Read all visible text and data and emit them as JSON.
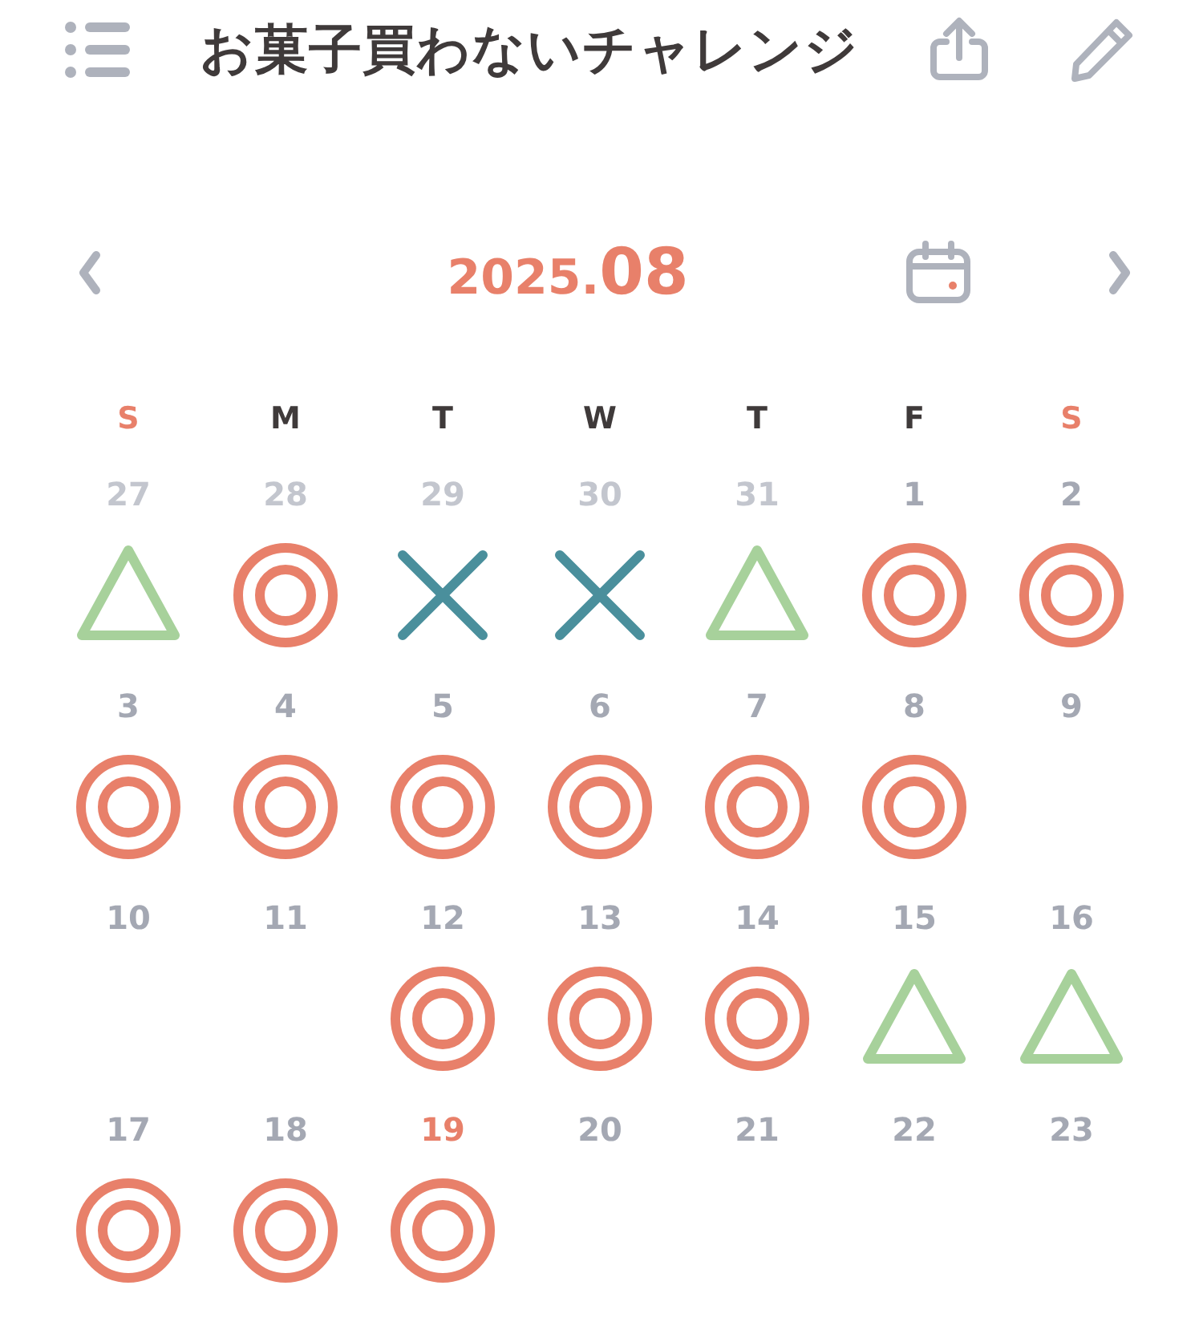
{
  "header": {
    "title": "お菓子買わないチャレンジ"
  },
  "month_nav": {
    "year": "2025.",
    "month": "08"
  },
  "weekdays": [
    {
      "label": "S",
      "holiday": true
    },
    {
      "label": "M",
      "holiday": false
    },
    {
      "label": "T",
      "holiday": false
    },
    {
      "label": "W",
      "holiday": false
    },
    {
      "label": "T",
      "holiday": false
    },
    {
      "label": "F",
      "holiday": false
    },
    {
      "label": "S",
      "holiday": true
    }
  ],
  "days": [
    {
      "day": "27",
      "kind": "outside",
      "mark": {
        "kind": "triangle"
      }
    },
    {
      "day": "28",
      "kind": "outside",
      "mark": {
        "kind": "double_circle"
      }
    },
    {
      "day": "29",
      "kind": "outside",
      "mark": {
        "kind": "cross"
      }
    },
    {
      "day": "30",
      "kind": "outside",
      "mark": {
        "kind": "cross"
      }
    },
    {
      "day": "31",
      "kind": "outside",
      "mark": {
        "kind": "triangle"
      }
    },
    {
      "day": "1",
      "kind": "inside",
      "mark": {
        "kind": "double_circle"
      }
    },
    {
      "day": "2",
      "kind": "inside",
      "mark": {
        "kind": "double_circle"
      }
    },
    {
      "day": "3",
      "kind": "inside",
      "mark": {
        "kind": "double_circle"
      }
    },
    {
      "day": "4",
      "kind": "inside",
      "mark": {
        "kind": "double_circle"
      }
    },
    {
      "day": "5",
      "kind": "inside",
      "mark": {
        "kind": "double_circle"
      }
    },
    {
      "day": "6",
      "kind": "inside",
      "mark": {
        "kind": "double_circle"
      }
    },
    {
      "day": "7",
      "kind": "inside",
      "mark": {
        "kind": "double_circle"
      }
    },
    {
      "day": "8",
      "kind": "inside",
      "mark": {
        "kind": "double_circle"
      }
    },
    {
      "day": "9",
      "kind": "inside"
    },
    {
      "day": "10",
      "kind": "inside"
    },
    {
      "day": "11",
      "kind": "inside"
    },
    {
      "day": "12",
      "kind": "inside",
      "mark": {
        "kind": "double_circle"
      }
    },
    {
      "day": "13",
      "kind": "inside",
      "mark": {
        "kind": "double_circle"
      }
    },
    {
      "day": "14",
      "kind": "inside",
      "mark": {
        "kind": "double_circle"
      }
    },
    {
      "day": "15",
      "kind": "inside",
      "mark": {
        "kind": "triangle"
      }
    },
    {
      "day": "16",
      "kind": "inside",
      "mark": {
        "kind": "triangle"
      }
    },
    {
      "day": "17",
      "kind": "inside",
      "mark": {
        "kind": "double_circle"
      }
    },
    {
      "day": "18",
      "kind": "inside",
      "mark": {
        "kind": "double_circle"
      }
    },
    {
      "day": "19",
      "kind": "today",
      "mark": {
        "kind": "double_circle"
      }
    },
    {
      "day": "20",
      "kind": "inside"
    },
    {
      "day": "21",
      "kind": "inside"
    },
    {
      "day": "22",
      "kind": "inside"
    },
    {
      "day": "23",
      "kind": "inside"
    }
  ]
}
